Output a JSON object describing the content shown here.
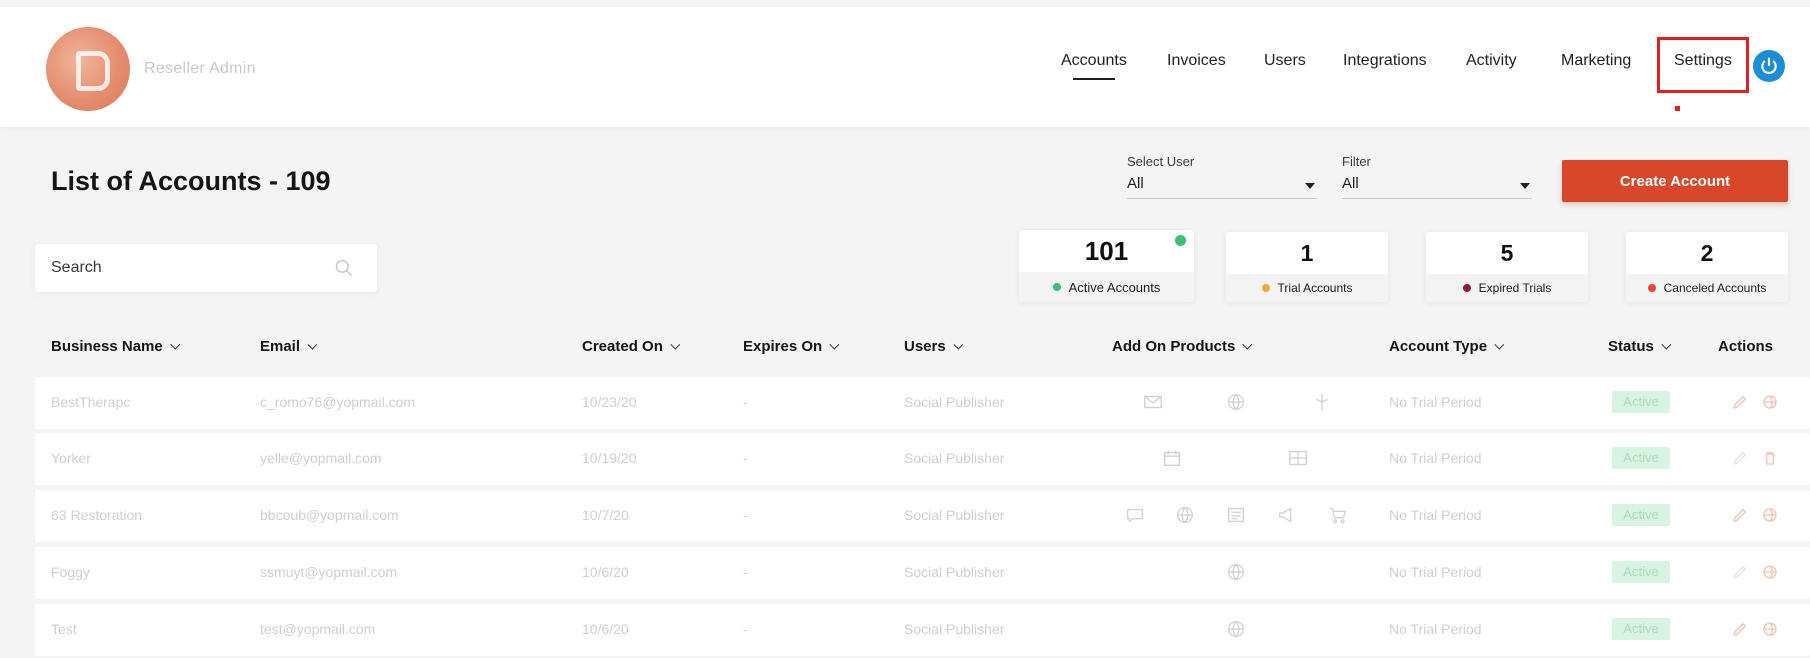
{
  "header": {
    "brand": "Reseller Admin",
    "nav": [
      {
        "label": "Accounts",
        "active": true
      },
      {
        "label": "Invoices"
      },
      {
        "label": "Users"
      },
      {
        "label": "Integrations"
      },
      {
        "label": "Activity"
      },
      {
        "label": "Marketing"
      },
      {
        "label": "Settings"
      }
    ],
    "power_icon": "power-icon"
  },
  "page": {
    "title": "List of Accounts - 109",
    "select_user": {
      "label": "Select User",
      "value": "All"
    },
    "filter": {
      "label": "Filter",
      "value": "All"
    },
    "create_button": "Create Account",
    "search_placeholder": "Search"
  },
  "stats": [
    {
      "value": "101",
      "label": "Active Accounts",
      "color": "#3fbf75"
    },
    {
      "value": "1",
      "label": "Trial Accounts",
      "color": "#f2a93b"
    },
    {
      "value": "5",
      "label": "Expired Trials",
      "color": "#8e1a4a"
    },
    {
      "value": "2",
      "label": "Canceled Accounts",
      "color": "#e8453c"
    }
  ],
  "table": {
    "columns": [
      "Business Name",
      "Email",
      "Created On",
      "Expires On",
      "Users",
      "Add On Products",
      "Account Type",
      "Status",
      "Actions"
    ],
    "rows": [
      {
        "business": "BestTherapc",
        "email": "c_romo76@yopmail.com",
        "created": "10/23/20",
        "expires": "-",
        "users": "Social Publisher",
        "account_type": "No Trial Period",
        "status": "Active"
      },
      {
        "business": "Yorker",
        "email": "yelle@yopmail.com",
        "created": "10/19/20",
        "expires": "-",
        "users": "Social Publisher",
        "account_type": "No Trial Period",
        "status": "Active"
      },
      {
        "business": "63 Restoration",
        "email": "bbcoub@yopmail.com",
        "created": "10/7/20",
        "expires": "-",
        "users": "Social Publisher",
        "account_type": "No Trial Period",
        "status": "Active"
      },
      {
        "business": "Foggy",
        "email": "ssmuyt@yopmail.com",
        "created": "10/6/20",
        "expires": "-",
        "users": "Social Publisher",
        "account_type": "No Trial Period",
        "status": "Active"
      },
      {
        "business": "Test",
        "email": "test@yopmail.com",
        "created": "10/6/20",
        "expires": "-",
        "users": "Social Publisher",
        "account_type": "No Trial Period",
        "status": "Active"
      }
    ]
  }
}
